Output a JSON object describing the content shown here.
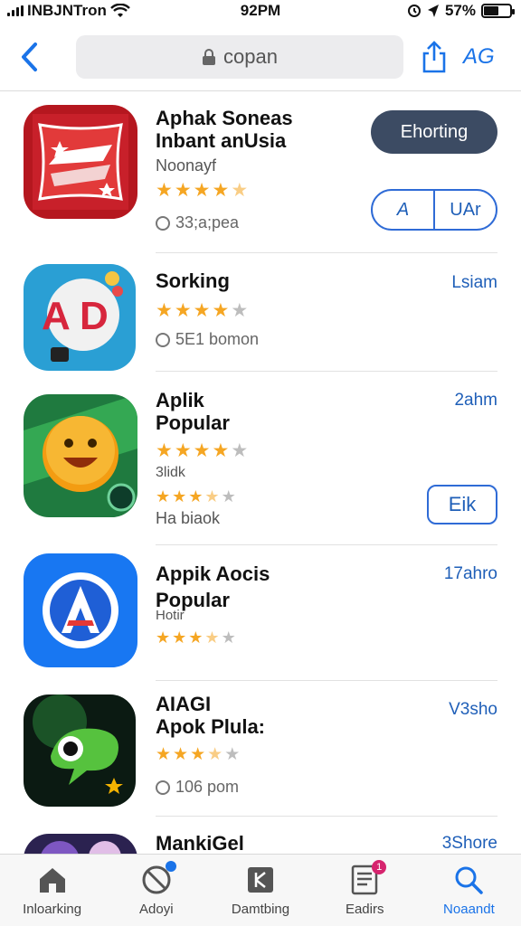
{
  "status": {
    "carrier": "INBJNTron",
    "time": "92PM",
    "battery": "57%",
    "battery_level": 0.57
  },
  "nav": {
    "search_text": "copan",
    "right_text": "AG"
  },
  "apps": [
    {
      "title1": "Aphak Soneas",
      "title2": "Inbant anUsia",
      "subtitle": "Noonayf",
      "rating": 4.5,
      "meta": "33;a;pea",
      "button_primary": "Ehorting",
      "split_left": "A",
      "split_right": "UAr"
    },
    {
      "title1": "Sorking",
      "right_label": "Lsiam",
      "rating": 4,
      "meta": "5E1 bomon"
    },
    {
      "title1": "Aplik",
      "title2": "Popular",
      "rating": 4,
      "sub_small": "3lidk",
      "rating2": 3.5,
      "meta": "Ha biaok",
      "right_label": "2ahm",
      "button_outline": "Eik"
    },
    {
      "title1": "Appik Aocis",
      "title2": "Popular",
      "subtitle_overlay": "Hotir",
      "right_label": "17ahro",
      "rating": 3.5
    },
    {
      "title1": "AIAGI",
      "title2": "Apok Plula:",
      "right_label": "V3sho",
      "rating": 3.5,
      "meta": "106 pom"
    },
    {
      "title1": "MankiGel",
      "right_label": "3Shore"
    }
  ],
  "tabs": [
    {
      "label": "Inloarking",
      "icon": "home-icon"
    },
    {
      "label": "Adoyi",
      "icon": "discover-icon",
      "badge_dot": true
    },
    {
      "label": "Damtbing",
      "icon": "grid-icon"
    },
    {
      "label": "Eadirs",
      "icon": "updates-icon",
      "badge": "1"
    },
    {
      "label": "Noaandt",
      "icon": "search-icon",
      "active": true
    }
  ],
  "colors": {
    "accent": "#1a73e8",
    "link": "#1f5fb8",
    "star": "#f5a623",
    "dark_button": "#3c4b63"
  }
}
